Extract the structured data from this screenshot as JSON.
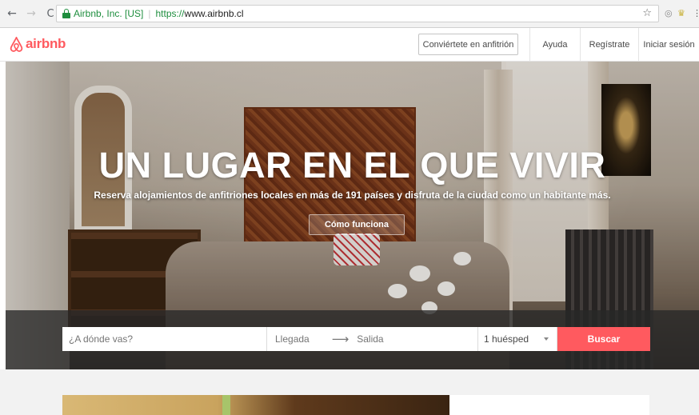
{
  "browser": {
    "back_glyph": "←",
    "forward_glyph": "→",
    "reload_glyph": "C",
    "cert_label": "Airbnb, Inc. [US]",
    "url_scheme": "https://",
    "url_host": "www.airbnb.cl",
    "star_glyph": "☆",
    "ext1_glyph": "◎",
    "ext2_glyph": "♛",
    "menu_glyph": "⋮"
  },
  "header": {
    "logo_text": "airbnb",
    "host_button": "Conviértete en anfitrión",
    "nav": [
      "Ayuda",
      "Regístrate",
      "Iniciar sesión"
    ]
  },
  "hero": {
    "title": "UN LUGAR EN EL QUE VIVIR",
    "subtitle": "Reserva alojamientos de anfitriones locales en más de 191 países y disfruta de la ciudad como un habitante más.",
    "how_button": "Cómo funciona"
  },
  "search": {
    "where_placeholder": "¿A dónde vas?",
    "checkin_placeholder": "Llegada",
    "arrow_glyph": "⟶",
    "checkout_placeholder": "Salida",
    "guests_value": "1 huésped",
    "search_button": "Buscar"
  },
  "colors": {
    "brand": "#ff5a5f",
    "secure": "#1e8e3e"
  }
}
